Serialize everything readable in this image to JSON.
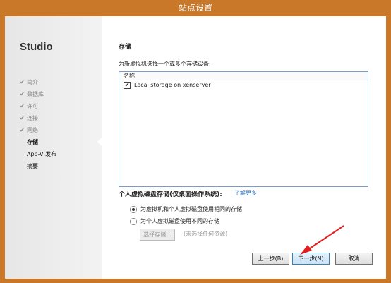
{
  "window": {
    "title": "站点设置"
  },
  "sidebar": {
    "brand": "Studio",
    "items": [
      {
        "label": "简介",
        "state": "done"
      },
      {
        "label": "数据库",
        "state": "done"
      },
      {
        "label": "许可",
        "state": "done"
      },
      {
        "label": "连接",
        "state": "done"
      },
      {
        "label": "网络",
        "state": "done"
      },
      {
        "label": "存储",
        "state": "active"
      },
      {
        "label": "App-V 发布",
        "state": "pending"
      },
      {
        "label": "摘要",
        "state": "pending"
      }
    ]
  },
  "main": {
    "heading": "存储",
    "prompt": "为新虚拟机选择一个或多个存储设备:",
    "list": {
      "column_header": "名称",
      "rows": [
        {
          "label": "Local storage on xenserver",
          "checked": true
        }
      ]
    },
    "pvd": {
      "heading": "个人虚拟磁盘存储(仅桌面操作系统):",
      "learn_more": "了解更多",
      "options": [
        {
          "label": "为虚拟机和个人虚拟磁盘使用相同的存储",
          "selected": true
        },
        {
          "label": "为个人虚拟磁盘使用不同的存储",
          "selected": false
        }
      ],
      "select_button": "选择存储...",
      "none_selected_hint": "(未选择任何资源)"
    }
  },
  "footer": {
    "back": "上一步(B)",
    "next": "下一步(N)",
    "cancel": "取消"
  },
  "colors": {
    "frame": "#c87828",
    "annotation_arrow": "#e02020",
    "link": "#2a6fb8"
  },
  "icons": {
    "checkmark": "check-icon"
  }
}
